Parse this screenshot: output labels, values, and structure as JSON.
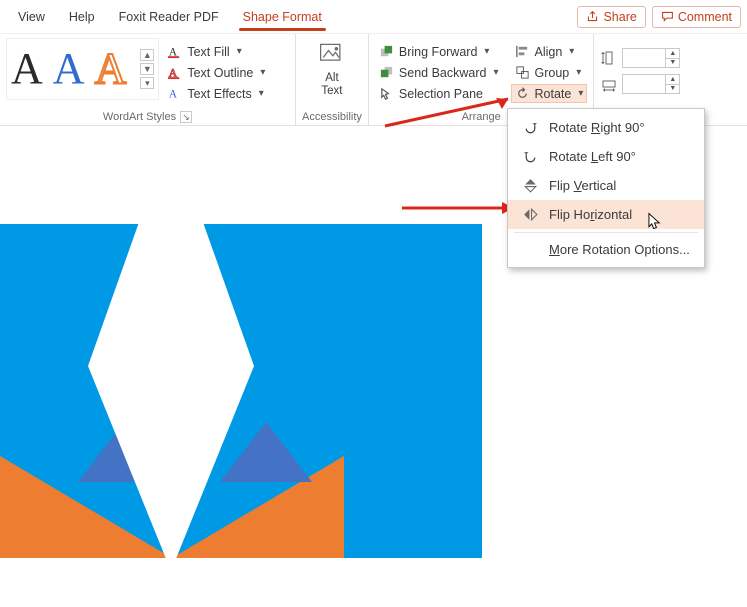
{
  "menubar": {
    "tabs": [
      "View",
      "Help",
      "Foxit Reader PDF",
      "Shape Format"
    ],
    "active_index": 3,
    "share": "Share",
    "comment": "Comment"
  },
  "ribbon": {
    "wordart": {
      "label": "WordArt Styles",
      "text_fill": "Text Fill",
      "text_outline": "Text Outline",
      "text_effects": "Text Effects"
    },
    "accessibility": {
      "label": "Accessibility",
      "alt_text_line1": "Alt",
      "alt_text_line2": "Text"
    },
    "arrange": {
      "label": "Arrange",
      "bring_forward": "Bring Forward",
      "send_backward": "Send Backward",
      "selection_pane": "Selection Pane",
      "align": "Align",
      "group": "Group",
      "rotate": "Rotate"
    },
    "size": {
      "height_val": "",
      "width_val": ""
    }
  },
  "rotate_menu": {
    "rotate_right_pre": "Rotate ",
    "rotate_right_u": "R",
    "rotate_right_post": "ight 90°",
    "rotate_left_pre": "Rotate ",
    "rotate_left_u": "L",
    "rotate_left_post": "eft 90°",
    "flip_vertical_pre": "Flip ",
    "flip_vertical_u": "V",
    "flip_vertical_post": "ertical",
    "flip_horizontal_pre": "Flip Ho",
    "flip_horizontal_u": "r",
    "flip_horizontal_post": "izontal",
    "more_pre": "",
    "more_u": "M",
    "more_post": "ore Rotation Options..."
  },
  "slide_colors": {
    "bg": "#0099e5",
    "orange": "#ed7d31",
    "blue": "#4472c4",
    "white": "#ffffff"
  }
}
